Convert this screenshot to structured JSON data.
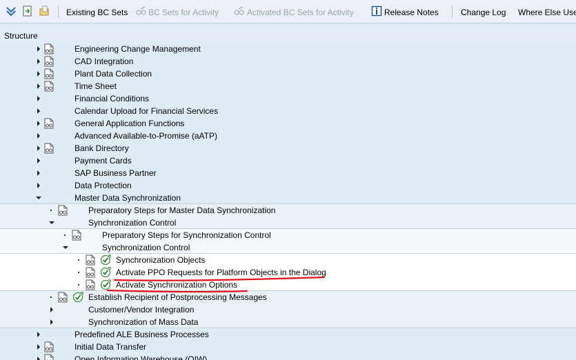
{
  "toolbar": {
    "existing_bc_sets": "Existing BC Sets",
    "bc_sets_for_activity": "BC Sets for Activity",
    "activated_bc_sets_for_activity": "Activated BC Sets for Activity",
    "release_notes": "Release Notes",
    "change_log": "Change Log",
    "where_else_used": "Where Else Use"
  },
  "structure": {
    "header": "Structure",
    "rows": [
      {
        "label": "Engineering Change Management",
        "level": 0,
        "toggle": "collapsed",
        "doc": true,
        "check": false
      },
      {
        "label": "CAD Integration",
        "level": 0,
        "toggle": "collapsed",
        "doc": true,
        "check": false
      },
      {
        "label": "Plant Data Collection",
        "level": 0,
        "toggle": "collapsed",
        "doc": true,
        "check": false
      },
      {
        "label": "Time Sheet",
        "level": 0,
        "toggle": "collapsed",
        "doc": true,
        "check": false
      },
      {
        "label": "Financial Conditions",
        "level": 0,
        "toggle": "collapsed",
        "doc": false,
        "check": false
      },
      {
        "label": "Calendar Upload for Financial Services",
        "level": 0,
        "toggle": "collapsed",
        "doc": false,
        "check": false
      },
      {
        "label": "General Application Functions",
        "level": 0,
        "toggle": "collapsed",
        "doc": true,
        "check": false
      },
      {
        "label": "Advanced Available-to-Promise (aATP)",
        "level": 0,
        "toggle": "collapsed",
        "doc": false,
        "check": false
      },
      {
        "label": "Bank Directory",
        "level": 0,
        "toggle": "collapsed",
        "doc": true,
        "check": false
      },
      {
        "label": "Payment Cards",
        "level": 0,
        "toggle": "collapsed",
        "doc": false,
        "check": false
      },
      {
        "label": "SAP Business Partner",
        "level": 0,
        "toggle": "collapsed",
        "doc": false,
        "check": false
      },
      {
        "label": "Data Protection",
        "level": 0,
        "toggle": "collapsed",
        "doc": false,
        "check": false
      },
      {
        "label": "Master Data Synchronization",
        "level": 0,
        "toggle": "expanded",
        "doc": false,
        "check": false
      },
      {
        "label": "Preparatory Steps for Master Data Synchronization",
        "level": 1,
        "toggle": "leaf",
        "doc": true,
        "check": false
      },
      {
        "label": "Synchronization Control",
        "level": 1,
        "toggle": "expanded",
        "doc": false,
        "check": false
      },
      {
        "label": "Preparatory Steps for Synchronization Control",
        "level": 2,
        "toggle": "leaf",
        "doc": true,
        "check": false
      },
      {
        "label": "Synchronization Control",
        "level": 2,
        "toggle": "expanded",
        "doc": false,
        "check": false
      },
      {
        "label": "Synchronization Objects",
        "level": 3,
        "toggle": "leaf",
        "doc": true,
        "check": true
      },
      {
        "label": "Activate PPO Requests for Platform Objects in the Dialog",
        "level": 3,
        "toggle": "leaf",
        "doc": true,
        "check": true
      },
      {
        "label": "Activate Synchronization Options",
        "level": 3,
        "toggle": "leaf",
        "doc": true,
        "check": true
      },
      {
        "label": "Establish Recipient of Postprocessing Messages",
        "level": 1,
        "toggle": "leaf",
        "doc": true,
        "check": true
      },
      {
        "label": "Customer/Vendor Integration",
        "level": 1,
        "toggle": "collapsed",
        "doc": false,
        "check": false
      },
      {
        "label": "Synchronization of Mass Data",
        "level": 1,
        "toggle": "collapsed",
        "doc": false,
        "check": false
      },
      {
        "label": "Predefined ALE Business Processes",
        "level": 0,
        "toggle": "collapsed",
        "doc": false,
        "check": false
      },
      {
        "label": "Initial Data Transfer",
        "level": 0,
        "toggle": "collapsed",
        "doc": true,
        "check": false
      },
      {
        "label": "Open Information Warehouse (OIW)",
        "level": 0,
        "toggle": "collapsed",
        "doc": true,
        "check": false
      }
    ]
  }
}
